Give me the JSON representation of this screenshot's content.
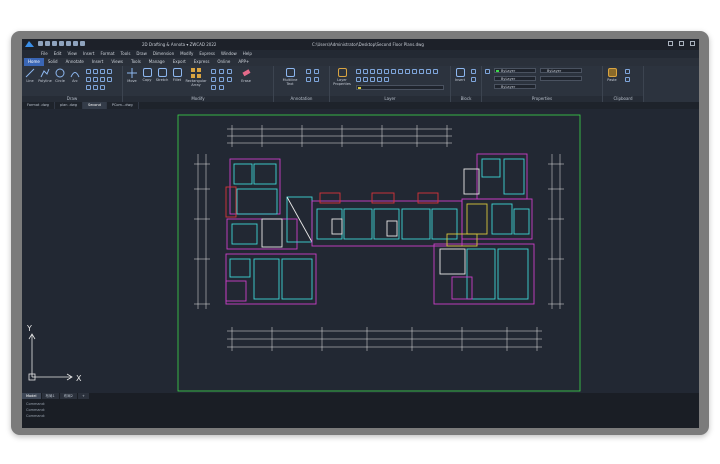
{
  "window": {
    "title": "2D Drafting & Annota ▾   ZWCAD 2022",
    "file_path": "C:\\Users\\Administrator\\Desktop\\Second Floor Plans.dwg"
  },
  "menu": [
    "File",
    "Edit",
    "View",
    "Insert",
    "Format",
    "Tools",
    "Draw",
    "Dimension",
    "Modify",
    "Express",
    "Window",
    "Help"
  ],
  "ribbon_tabs": [
    "Home",
    "Solid",
    "Annotate",
    "Insert",
    "Views",
    "Tools",
    "Manage",
    "Export",
    "Express",
    "Online",
    "APP+"
  ],
  "active_tab": "Home",
  "draw_tools": [
    "Line",
    "Polyline",
    "Circle",
    "Arc"
  ],
  "modify_tools": [
    "Move",
    "Copy",
    "Stretch",
    "Fillet",
    "Rectangular Array"
  ],
  "other_tools": {
    "erase": "Erase",
    "multiline": "Multiline Text",
    "layer": "Layer Properties",
    "insert": "Insert",
    "paste": "Paste"
  },
  "panels": {
    "draw": "Draw",
    "modify": "Modify",
    "annotation": "Annotation",
    "layer": "Layer",
    "block": "Block",
    "properties": "Properties",
    "clipboard": "Clipboard"
  },
  "properties": {
    "bylayer_1": "ByLayer",
    "bylayer_2": "ByLayer",
    "bylayer_3": "ByLayer",
    "bylayer_4": "ByLayer"
  },
  "doc_tabs": [
    "Format .dwg",
    "plan .dwg",
    "Second",
    "PCom...dwg"
  ],
  "active_doc": "Second",
  "axis": {
    "x": "X",
    "y": "Y"
  },
  "layout_tabs": [
    "Model",
    "布局1",
    "布局2",
    "+"
  ],
  "command_lines": [
    "Command:",
    "Command:",
    "Command:"
  ],
  "colors": {
    "magenta": "#cc3ec8",
    "cyan": "#3fd6d6",
    "green": "#3cd84a",
    "red": "#d8343a",
    "yellow": "#d8c63c",
    "white": "#e8e8e8",
    "accent": "#3a66b5"
  }
}
